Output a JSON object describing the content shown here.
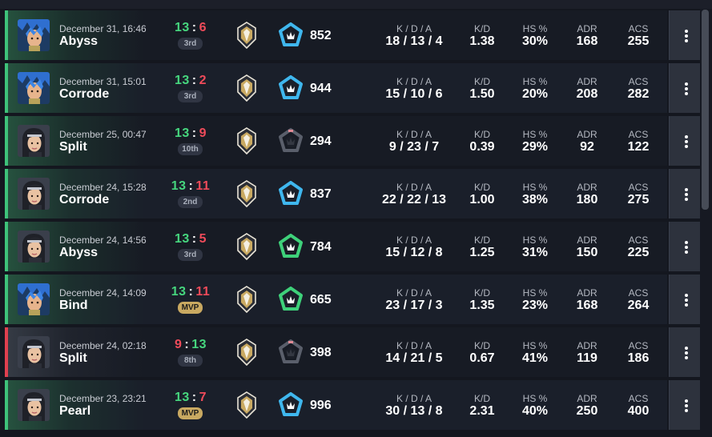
{
  "matches": [
    {
      "date": "December 31, 16:46",
      "map": "Abyss",
      "score_won": "13",
      "score_lost": "6",
      "result": "win",
      "placement": "3rd",
      "agent": "blue-hair-agent",
      "rr_tier": "blue-icon",
      "rr": "852",
      "kda": "18 / 13 / 4",
      "kd": "1.38",
      "hs": "30%",
      "adr": "168",
      "acs": "255"
    },
    {
      "date": "December 31, 15:01",
      "map": "Corrode",
      "score_won": "13",
      "score_lost": "2",
      "result": "win",
      "placement": "3rd",
      "agent": "blue-hair-agent",
      "rr_tier": "blue-icon",
      "rr": "944",
      "kda": "15 / 10 / 6",
      "kd": "1.50",
      "hs": "20%",
      "adr": "208",
      "acs": "282"
    },
    {
      "date": "December 25, 00:47",
      "map": "Split",
      "score_won": "13",
      "score_lost": "9",
      "result": "win",
      "placement": "10th",
      "agent": "dark-hair-agent",
      "rr_tier": "gray-icon",
      "rr": "294",
      "kda": "9 / 23 / 7",
      "kd": "0.39",
      "hs": "29%",
      "adr": "92",
      "acs": "122"
    },
    {
      "date": "December 24, 15:28",
      "map": "Corrode",
      "score_won": "13",
      "score_lost": "11",
      "result": "win",
      "placement": "2nd",
      "agent": "dark-hair-agent",
      "rr_tier": "blue-icon",
      "rr": "837",
      "kda": "22 / 22 / 13",
      "kd": "1.00",
      "hs": "38%",
      "adr": "180",
      "acs": "275"
    },
    {
      "date": "December 24, 14:56",
      "map": "Abyss",
      "score_won": "13",
      "score_lost": "5",
      "result": "win",
      "placement": "3rd",
      "agent": "dark-hair-agent",
      "rr_tier": "green-icon",
      "rr": "784",
      "kda": "15 / 12 / 8",
      "kd": "1.25",
      "hs": "31%",
      "adr": "150",
      "acs": "225"
    },
    {
      "date": "December 24, 14:09",
      "map": "Bind",
      "score_won": "13",
      "score_lost": "11",
      "result": "win",
      "placement": "MVP",
      "agent": "blue-hair-agent",
      "rr_tier": "green-icon",
      "rr": "665",
      "kda": "23 / 17 / 3",
      "kd": "1.35",
      "hs": "23%",
      "adr": "168",
      "acs": "264"
    },
    {
      "date": "December 24, 02:18",
      "map": "Split",
      "score_won": "9",
      "score_lost": "13",
      "result": "loss",
      "placement": "8th",
      "agent": "dark-hair-agent",
      "rr_tier": "gray-icon",
      "rr": "398",
      "kda": "14 / 21 / 5",
      "kd": "0.67",
      "hs": "41%",
      "adr": "119",
      "acs": "186"
    },
    {
      "date": "December 23, 23:21",
      "map": "Pearl",
      "score_won": "13",
      "score_lost": "7",
      "result": "win",
      "placement": "MVP",
      "agent": "dark-hair-agent",
      "rr_tier": "blue-icon",
      "rr": "996",
      "kda": "30 / 13 / 8",
      "kd": "2.31",
      "hs": "40%",
      "adr": "250",
      "acs": "400"
    }
  ],
  "labels": {
    "kda": "K / D / A",
    "kd": "K/D",
    "hs": "HS %",
    "adr": "ADR",
    "acs": "ACS"
  },
  "colors": {
    "win": "#46d67e",
    "loss": "#ef4b5a",
    "mvp": "#c9a961",
    "blue": "#3fb7ee",
    "green": "#3ed17a",
    "gray": "#5a5f6b"
  }
}
